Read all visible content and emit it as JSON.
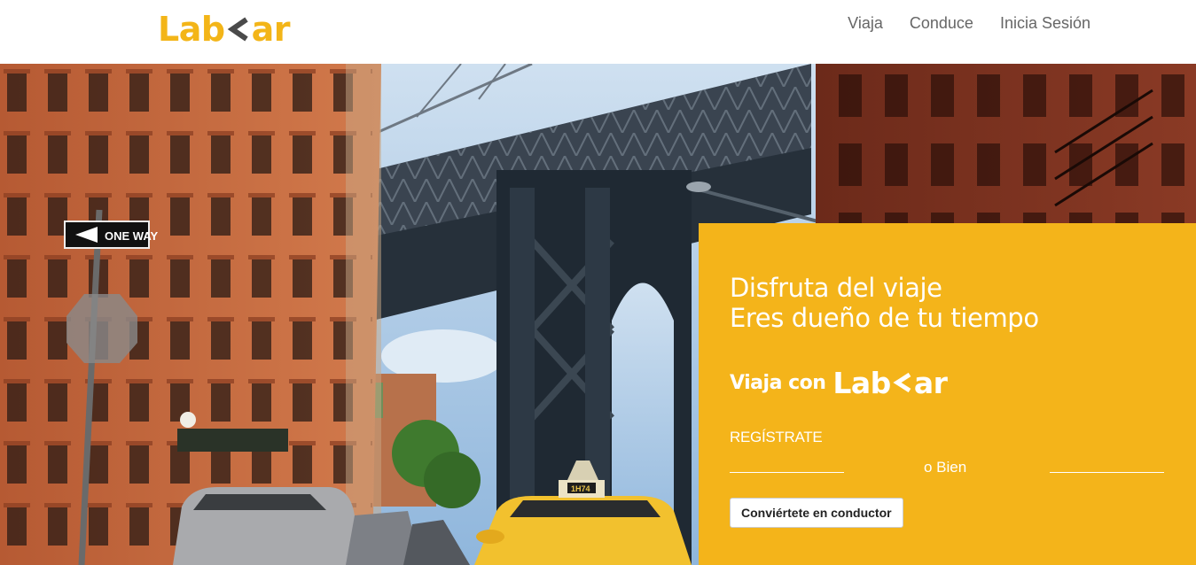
{
  "brand": {
    "logo_prefix": "Lab",
    "logo_suffix": "ar",
    "color_primary": "#f3b518",
    "color_dark": "#4a4a4a"
  },
  "nav": {
    "items": [
      {
        "label": "Viaja"
      },
      {
        "label": "Conduce"
      },
      {
        "label": "Inicia Sesión"
      }
    ]
  },
  "hero": {
    "tagline_line1": "Disfruta del viaje",
    "tagline_line2": "Eres dueño de tu tiempo",
    "viaja_con": "Viaja con",
    "register_link": "REGÍSTRATE",
    "or_text": "o Bien",
    "driver_button": "Conviértete en conductor",
    "panel_color": "#f4b41a"
  },
  "photo": {
    "sign_text": "ONE WAY",
    "taxi_sign": "1H74"
  }
}
